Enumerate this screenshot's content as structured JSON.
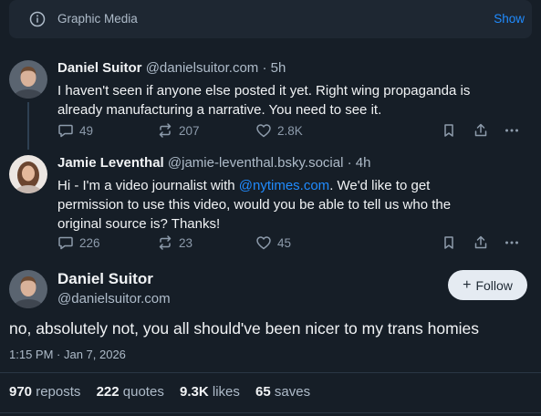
{
  "banner": {
    "label": "Graphic Media",
    "action": "Show",
    "icon": "info-icon"
  },
  "colors": {
    "background": "#161e27",
    "accent": "#208bfe",
    "muted": "#aebbc9"
  },
  "posts": [
    {
      "author": "Daniel Suitor",
      "handle": "@danielsuitor.com",
      "time": "· 5h",
      "text": "I haven't seen if anyone else posted it yet. Right wing propaganda is already manufacturing a narrative. You need to see it.",
      "replies": "49",
      "reposts": "207",
      "likes": "2.8K"
    },
    {
      "author": "Jamie Leventhal",
      "handle": "@jamie-leventhal.bsky.social",
      "time": "· 4h",
      "text_before": "Hi - I'm a video journalist with ",
      "mention": "@nytimes.com",
      "text_after": ". We'd like to get permission to use this video, would you be able to tell us who the original source is? Thanks!",
      "replies": "226",
      "reposts": "23",
      "likes": "45"
    }
  ],
  "main_post": {
    "author": "Daniel Suitor",
    "handle": "@danielsuitor.com",
    "follow_label": "Follow",
    "text": "no, absolutely not, you all should've been nicer to my trans homies",
    "timestamp": "1:15 PM · Jan 7, 2026",
    "stats": {
      "reposts_count": "970",
      "reposts_label": "reposts",
      "quotes_count": "222",
      "quotes_label": "quotes",
      "likes_count": "9.3K",
      "likes_label": "likes",
      "saves_count": "65",
      "saves_label": "saves"
    }
  }
}
